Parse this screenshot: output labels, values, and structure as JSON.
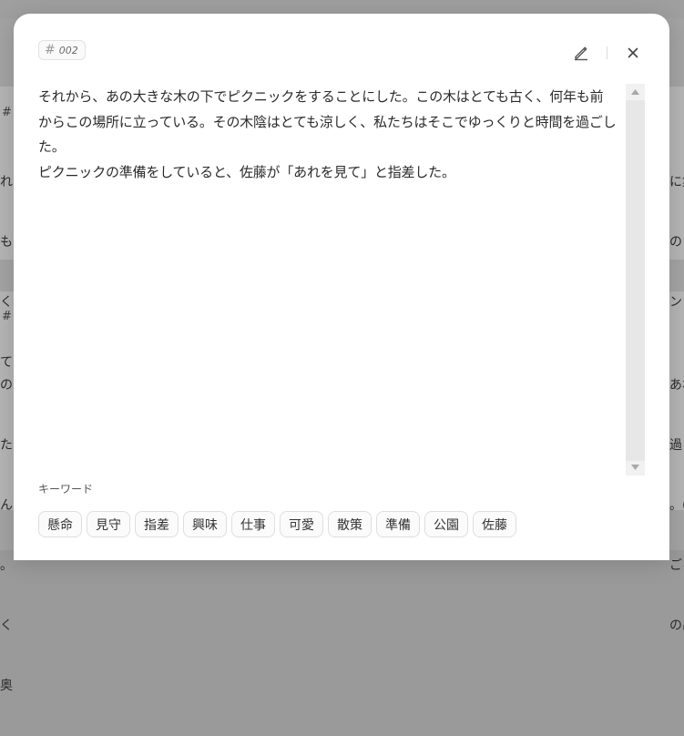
{
  "background": {
    "left_card_top_lines": [
      "れ",
      "も",
      "く、",
      "て"
    ],
    "left_card_bottom_lines": [
      "の",
      "た",
      "んた",
      "。ä",
      "く々",
      "奥"
    ],
    "right_card_top_lines": [
      "に集",
      "のリ",
      "ンド"
    ],
    "right_card_bottom_lines": [
      "あれ",
      "過ご",
      "。(",
      "ごろ",
      "の出"
    ],
    "hash_top": "# (",
    "hash_bottom": "# ("
  },
  "modal": {
    "tag": {
      "hash": "#",
      "number": "002"
    },
    "edit_icon": "pencil-icon",
    "close_icon": "close-icon",
    "paragraphs": [
      "それから、あの大きな木の下でピクニックをすることにした。この木はとても古く、何年も前からこの場所に立っている。その木陰はとても涼しく、私たちはそこでゆっくりと時間を過ごした。",
      "ピクニックの準備をしていると、佐藤が「あれを見て」と指差した。"
    ],
    "keywords_label": "キーワード",
    "keywords": [
      "懸命",
      "見守",
      "指差",
      "興味",
      "仕事",
      "可愛",
      "散策",
      "準備",
      "公園",
      "佐藤"
    ]
  }
}
